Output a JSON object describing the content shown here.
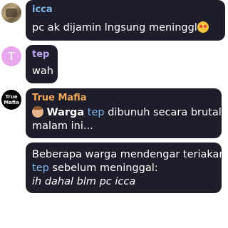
{
  "messages": [
    {
      "sender": "icca",
      "text": "pc ak dijamin lngsung meninggl",
      "emoji": "heart-eyes"
    },
    {
      "sender": "tep",
      "avatar_letter": "T",
      "text": "wah"
    },
    {
      "sender": "True Mafia",
      "avatar_text": "True Mafia",
      "line1_bold": "Warga",
      "line1_name": "tep",
      "line1_rest": " dibunuh secara brutal",
      "line2": "malam ini...",
      "emoji": "face"
    },
    {
      "line1": "Beberapa warga mendengar teriakan",
      "line2_name": "tep",
      "line2_rest": " sebelum meninggal:",
      "line3": "ih dahal blm pc icca"
    }
  ],
  "colors": {
    "bubble": "#1e1e2a",
    "name_icca": "#7fb6ea",
    "name_tep": "#b9a3f0",
    "name_mafia": "#f0a95a",
    "highlight": "#7fb6ea"
  }
}
